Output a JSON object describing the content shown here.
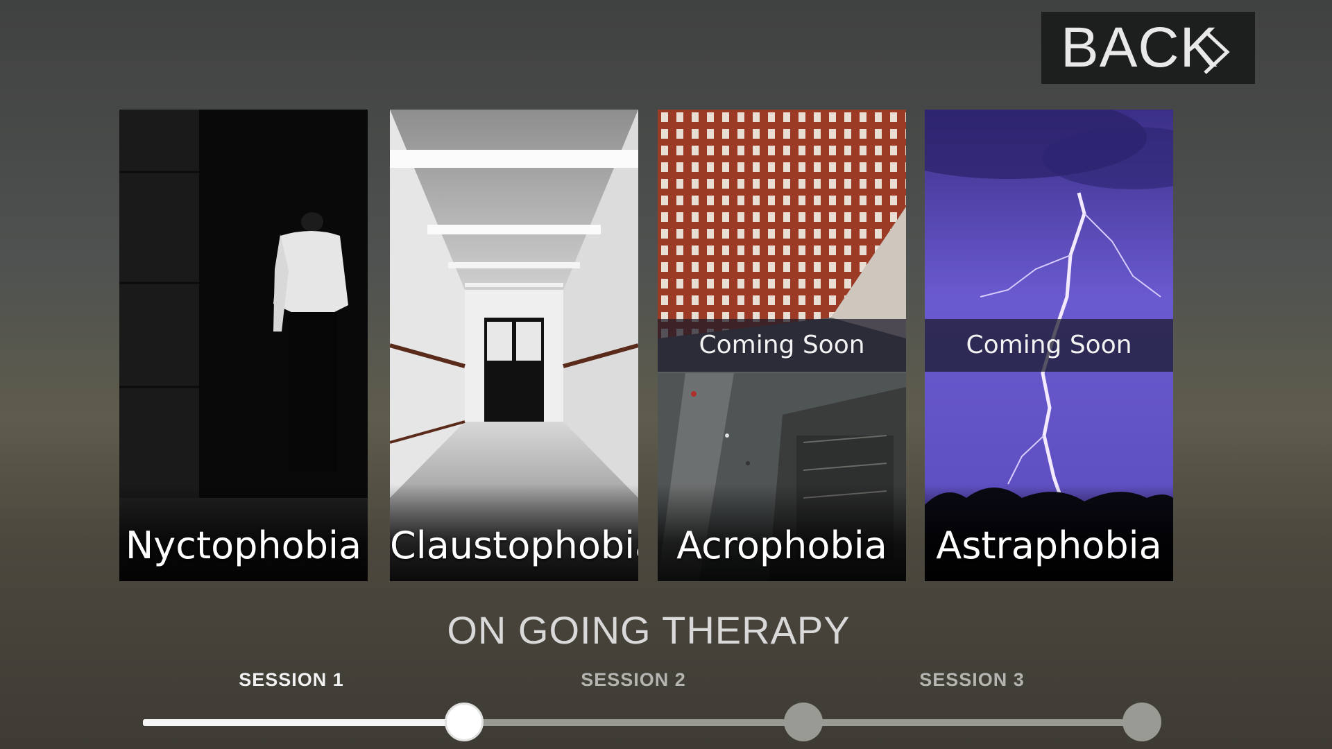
{
  "header": {
    "back_label": "BACK"
  },
  "cards": [
    {
      "name": "Nyctophobia",
      "coming_soon": ""
    },
    {
      "name": "Claustophobia",
      "coming_soon": ""
    },
    {
      "name": "Acrophobia",
      "coming_soon": "Coming Soon"
    },
    {
      "name": "Astraphobia",
      "coming_soon": "Coming Soon"
    }
  ],
  "therapy": {
    "title": "ON GOING THERAPY",
    "sessions": [
      "SESSION 1",
      "SESSION 2",
      "SESSION 3"
    ],
    "current_session": 1
  },
  "colors": {
    "accent": "#ffffff",
    "inactive": "#9a9a95"
  }
}
